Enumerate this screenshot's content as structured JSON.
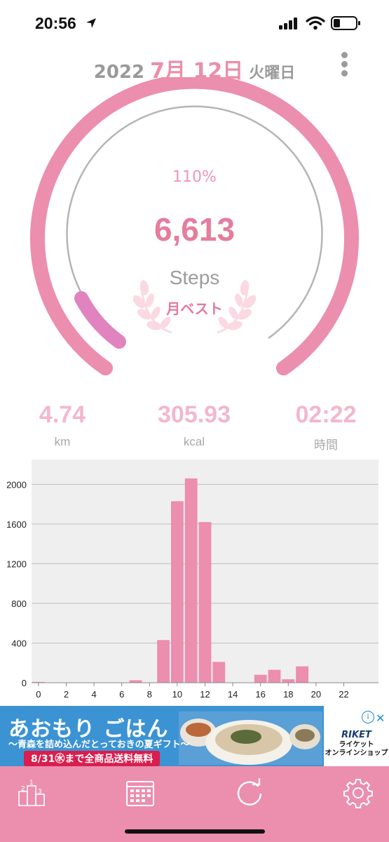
{
  "status_bar": {
    "time": "20:56"
  },
  "header": {
    "year": "2022",
    "month_day": "7月 12日",
    "weekday": "火曜日"
  },
  "gauge": {
    "percent_label": "110%",
    "steps": "6,613",
    "unit": "Steps",
    "badge": "月ベスト",
    "progress_fraction": 1.1
  },
  "stats": [
    {
      "value": "4.74",
      "label": "km"
    },
    {
      "value": "305.93",
      "label": "kcal"
    },
    {
      "value": "02:22",
      "label": "時間"
    }
  ],
  "chart_data": {
    "type": "bar",
    "x": [
      0,
      1,
      2,
      3,
      4,
      5,
      6,
      7,
      8,
      9,
      10,
      11,
      12,
      13,
      14,
      15,
      16,
      17,
      18,
      19,
      20,
      21,
      22,
      23
    ],
    "values": [
      8,
      0,
      0,
      0,
      0,
      0,
      0,
      25,
      0,
      430,
      1830,
      2060,
      1620,
      210,
      0,
      0,
      80,
      130,
      35,
      165,
      0,
      0,
      0,
      0
    ],
    "xticks": [
      "0",
      "2",
      "4",
      "6",
      "8",
      "10",
      "12",
      "14",
      "16",
      "18",
      "20",
      "22"
    ],
    "yticks": [
      "0",
      "400",
      "800",
      "1200",
      "1600",
      "2000"
    ],
    "ylim": [
      0,
      2250
    ],
    "grid": true,
    "bar_color": "#ec8ead",
    "background": "#efefef"
  },
  "ad": {
    "title": "あおもり ごはん",
    "subtitle": "～青森を詰め込んだとっておきの夏ギフト～",
    "promo": "8/31㊌まで全商品送料無料",
    "brand": "RIKET",
    "shop": "ライケット\nオンラインショップ",
    "info": "i",
    "close": "✕"
  },
  "tabs": [
    "ranking-icon",
    "calendar-icon",
    "refresh-icon",
    "settings-icon"
  ],
  "colors": {
    "accent": "#ec8ead",
    "accent_dark": "#e57d9d",
    "progress": "#e183be",
    "grey": "#9a9a9a"
  }
}
